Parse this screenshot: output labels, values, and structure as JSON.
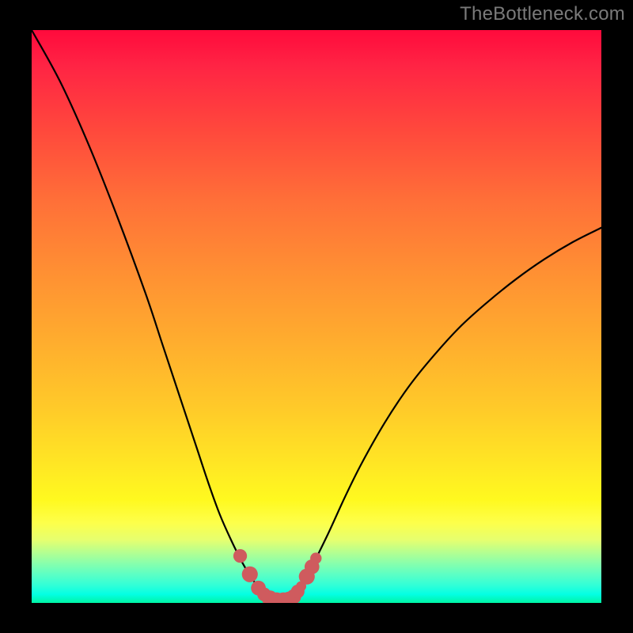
{
  "watermark": "TheBottleneck.com",
  "colors": {
    "frame": "#000000",
    "curve": "#000000",
    "markers": "#cf5b5e",
    "gradient_top": "#ff0a3c",
    "gradient_bottom": "#00f4a4"
  },
  "chart_data": {
    "type": "line",
    "title": "",
    "xlabel": "",
    "ylabel": "",
    "xlim": [
      0,
      100
    ],
    "ylim": [
      0,
      100
    ],
    "series": [
      {
        "name": "bottleneck-curve",
        "x": [
          0,
          5,
          10,
          15,
          20,
          23,
          26,
          29,
          31,
          33,
          35,
          37,
          38.5,
          40,
          41,
          42,
          43,
          44,
          45,
          46,
          47,
          49,
          52,
          55,
          58,
          62,
          66,
          70,
          75,
          80,
          85,
          90,
          95,
          100
        ],
        "y": [
          100,
          91,
          80,
          67.5,
          54,
          45,
          36,
          27,
          21,
          15.5,
          11,
          7,
          4.5,
          2.5,
          1.5,
          0.8,
          0.4,
          0.3,
          0.5,
          1.2,
          2.5,
          6,
          12,
          18.5,
          24.5,
          31.5,
          37.5,
          42.5,
          48,
          52.5,
          56.5,
          60,
          63,
          65.5
        ]
      }
    ],
    "markers": [
      {
        "x": 36.6,
        "y": 8.2,
        "r": 1.2
      },
      {
        "x": 38.3,
        "y": 5.0,
        "r": 1.4
      },
      {
        "x": 39.8,
        "y": 2.6,
        "r": 1.3
      },
      {
        "x": 40.8,
        "y": 1.5,
        "r": 1.2
      },
      {
        "x": 41.8,
        "y": 0.8,
        "r": 1.4
      },
      {
        "x": 43.0,
        "y": 0.35,
        "r": 1.5
      },
      {
        "x": 44.2,
        "y": 0.35,
        "r": 1.5
      },
      {
        "x": 45.2,
        "y": 0.6,
        "r": 1.4
      },
      {
        "x": 46.0,
        "y": 1.1,
        "r": 1.3
      },
      {
        "x": 46.7,
        "y": 2.0,
        "r": 1.2
      },
      {
        "x": 47.3,
        "y": 2.9,
        "r": 0.9
      },
      {
        "x": 48.3,
        "y": 4.6,
        "r": 1.4
      },
      {
        "x": 49.2,
        "y": 6.3,
        "r": 1.3
      },
      {
        "x": 49.9,
        "y": 7.8,
        "r": 1.0
      }
    ]
  }
}
